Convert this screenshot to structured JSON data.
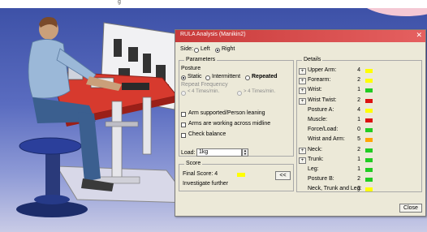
{
  "top_caption": "g",
  "dialog": {
    "title": "RULA Analysis (Manikin2)",
    "side_label": "Side:",
    "side_options": [
      "Left",
      "Right"
    ],
    "side_selected": "Right",
    "parameters_legend": "Parameters",
    "posture_label": "Posture",
    "posture_options": [
      "Static",
      "Intermittent",
      "Repeated"
    ],
    "posture_selected": "Static",
    "repeat_frequency_label": "Repeat Frequency",
    "repeat_options": [
      "< 4 Times/min.",
      "> 4 Times/min."
    ],
    "checkboxes": [
      "Arm supported/Person leaning",
      "Arms are working across midline",
      "Check balance"
    ],
    "load_label": "Load:",
    "load_value": "1kg",
    "score_legend": "Score",
    "final_score_label": "Final Score: 4",
    "final_score_color": "#ffff00",
    "investigate_text": "Investigate further",
    "collapse_button": "<<",
    "details_legend": "Details",
    "details": [
      {
        "label": "Upper Arm:",
        "value": "4",
        "color": "#ffff00",
        "plus": true
      },
      {
        "label": "Forearm:",
        "value": "2",
        "color": "#ffff00",
        "plus": true
      },
      {
        "label": "Wrist:",
        "value": "1",
        "color": "#22cc22",
        "plus": true
      },
      {
        "label": "Wrist Twist:",
        "value": "2",
        "color": "#dd1111",
        "plus": true
      },
      {
        "label": "Posture A:",
        "value": "4",
        "color": "#ffff00",
        "plus": false
      },
      {
        "label": "Muscle:",
        "value": "1",
        "color": "#dd1111",
        "plus": false
      },
      {
        "label": "Force/Load:",
        "value": "0",
        "color": "#22cc22",
        "plus": false
      },
      {
        "label": "Wrist and Arm:",
        "value": "5",
        "color": "#ffa500",
        "plus": false
      },
      {
        "label": "Neck:",
        "value": "2",
        "color": "#22cc22",
        "plus": true
      },
      {
        "label": "Trunk:",
        "value": "1",
        "color": "#22cc22",
        "plus": true
      },
      {
        "label": "Leg:",
        "value": "1",
        "color": "#22cc22",
        "plus": false
      },
      {
        "label": "Posture B:",
        "value": "2",
        "color": "#22cc22",
        "plus": false
      },
      {
        "label": "Neck, Trunk and Leg:",
        "value": "3",
        "color": "#ffff00",
        "plus": false
      }
    ],
    "close_button": "Close"
  }
}
